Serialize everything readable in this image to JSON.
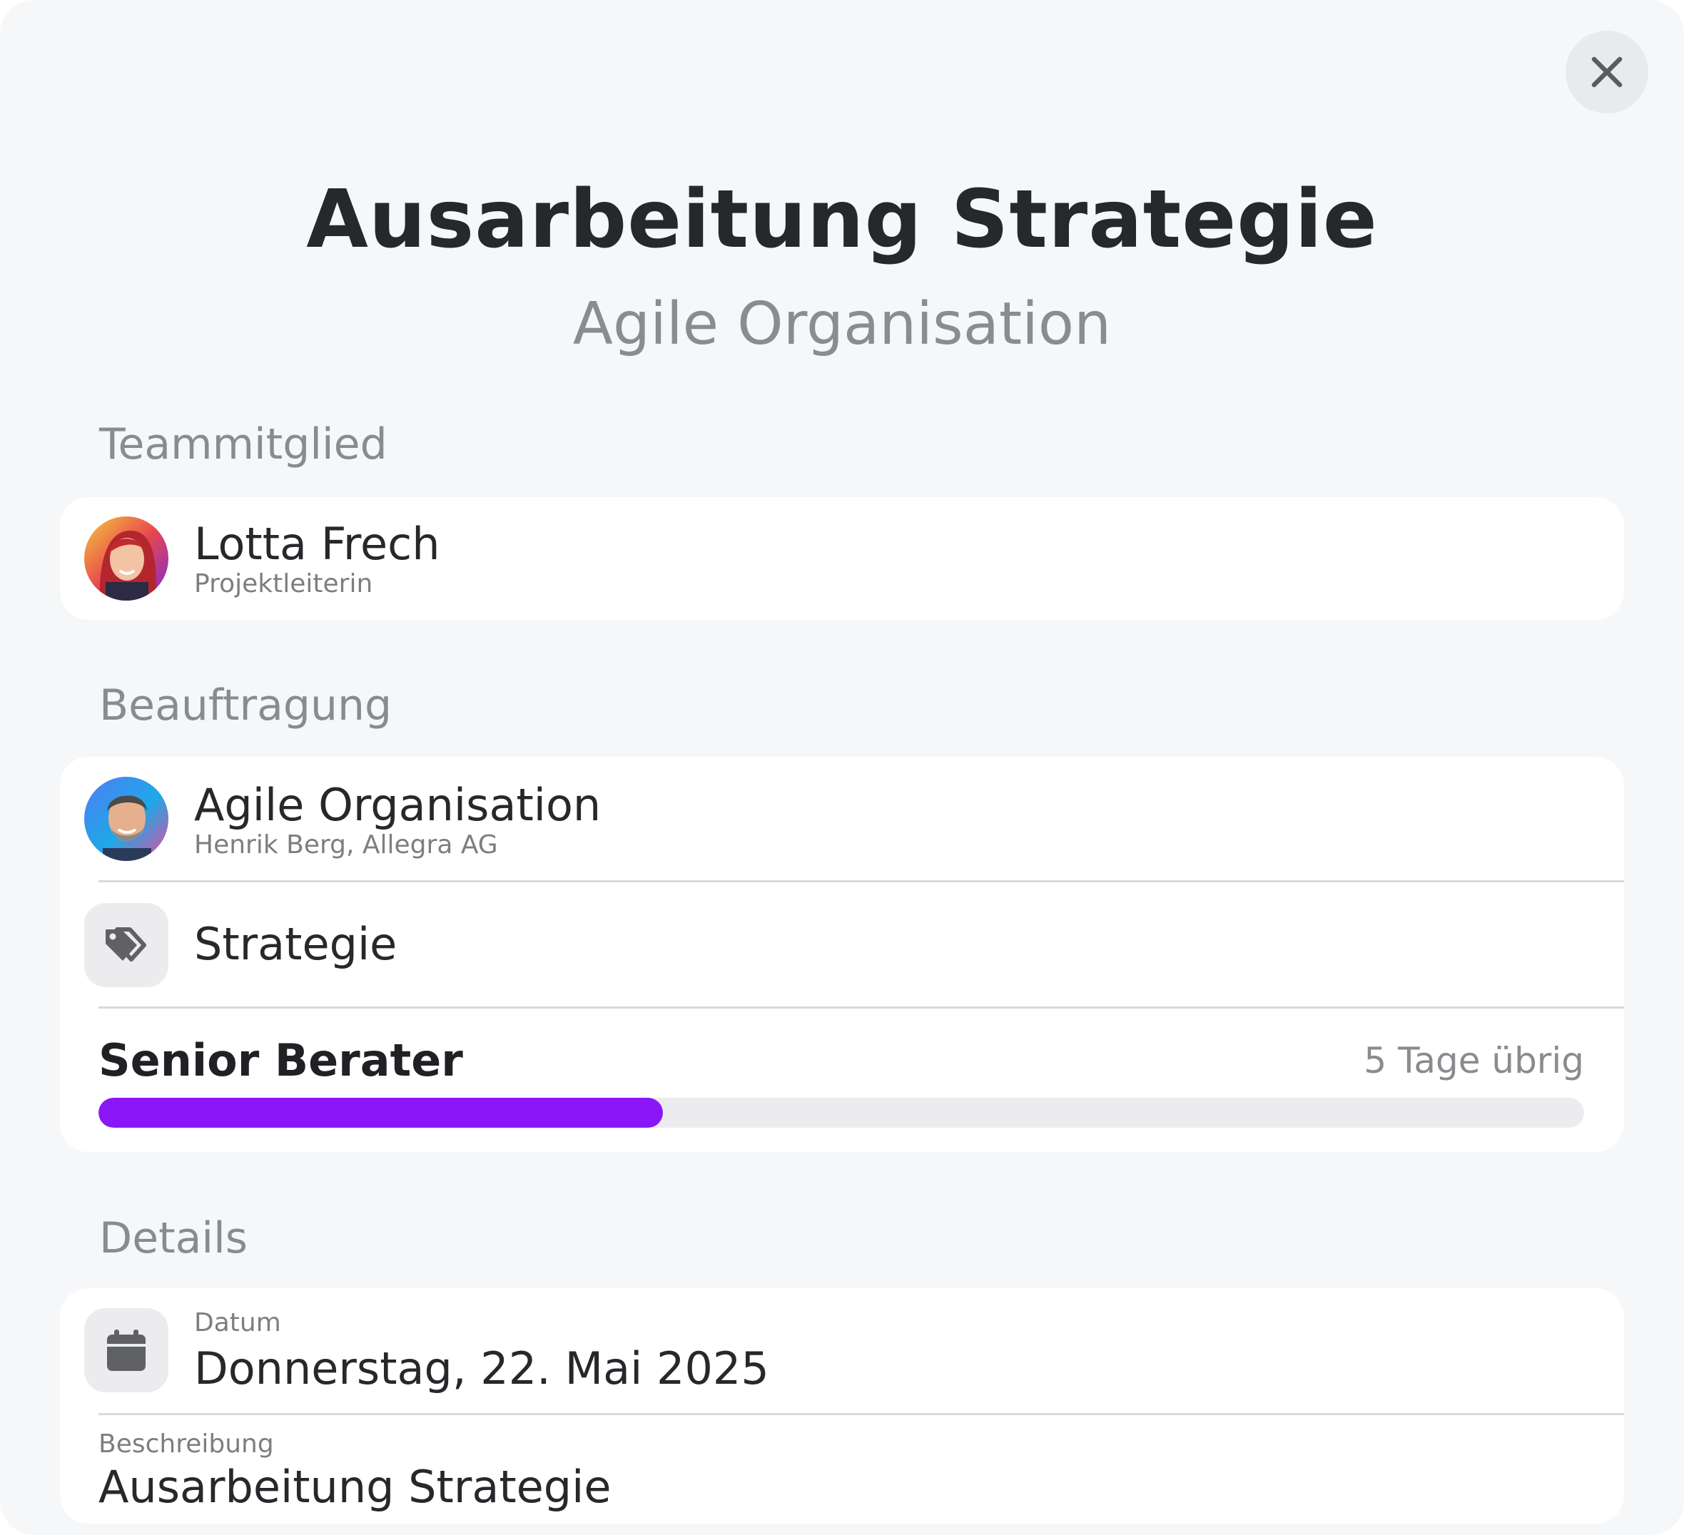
{
  "header": {
    "title": "Ausarbeitung Strategie",
    "subtitle": "Agile Organisation",
    "close_icon": "close-icon"
  },
  "team_section": {
    "label": "Teammitglied",
    "member": {
      "name": "Lotta Frech",
      "role": "Projektleiterin"
    }
  },
  "assignment_section": {
    "label": "Beauftragung",
    "project": {
      "name": "Agile Organisation",
      "client": "Henrik Berg, Allegra AG"
    },
    "category": {
      "icon": "tag-icon",
      "label": "Strategie"
    },
    "budget": {
      "role": "Senior Berater",
      "remaining": "5 Tage übrig",
      "progress_fraction": 0.38,
      "accent_color": "#8a16f7"
    }
  },
  "details_section": {
    "label": "Details",
    "date": {
      "icon": "calendar-icon",
      "label": "Datum",
      "value": "Donnerstag, 22. Mai 2025"
    },
    "description": {
      "label": "Beschreibung",
      "value": "Ausarbeitung Strategie"
    }
  }
}
